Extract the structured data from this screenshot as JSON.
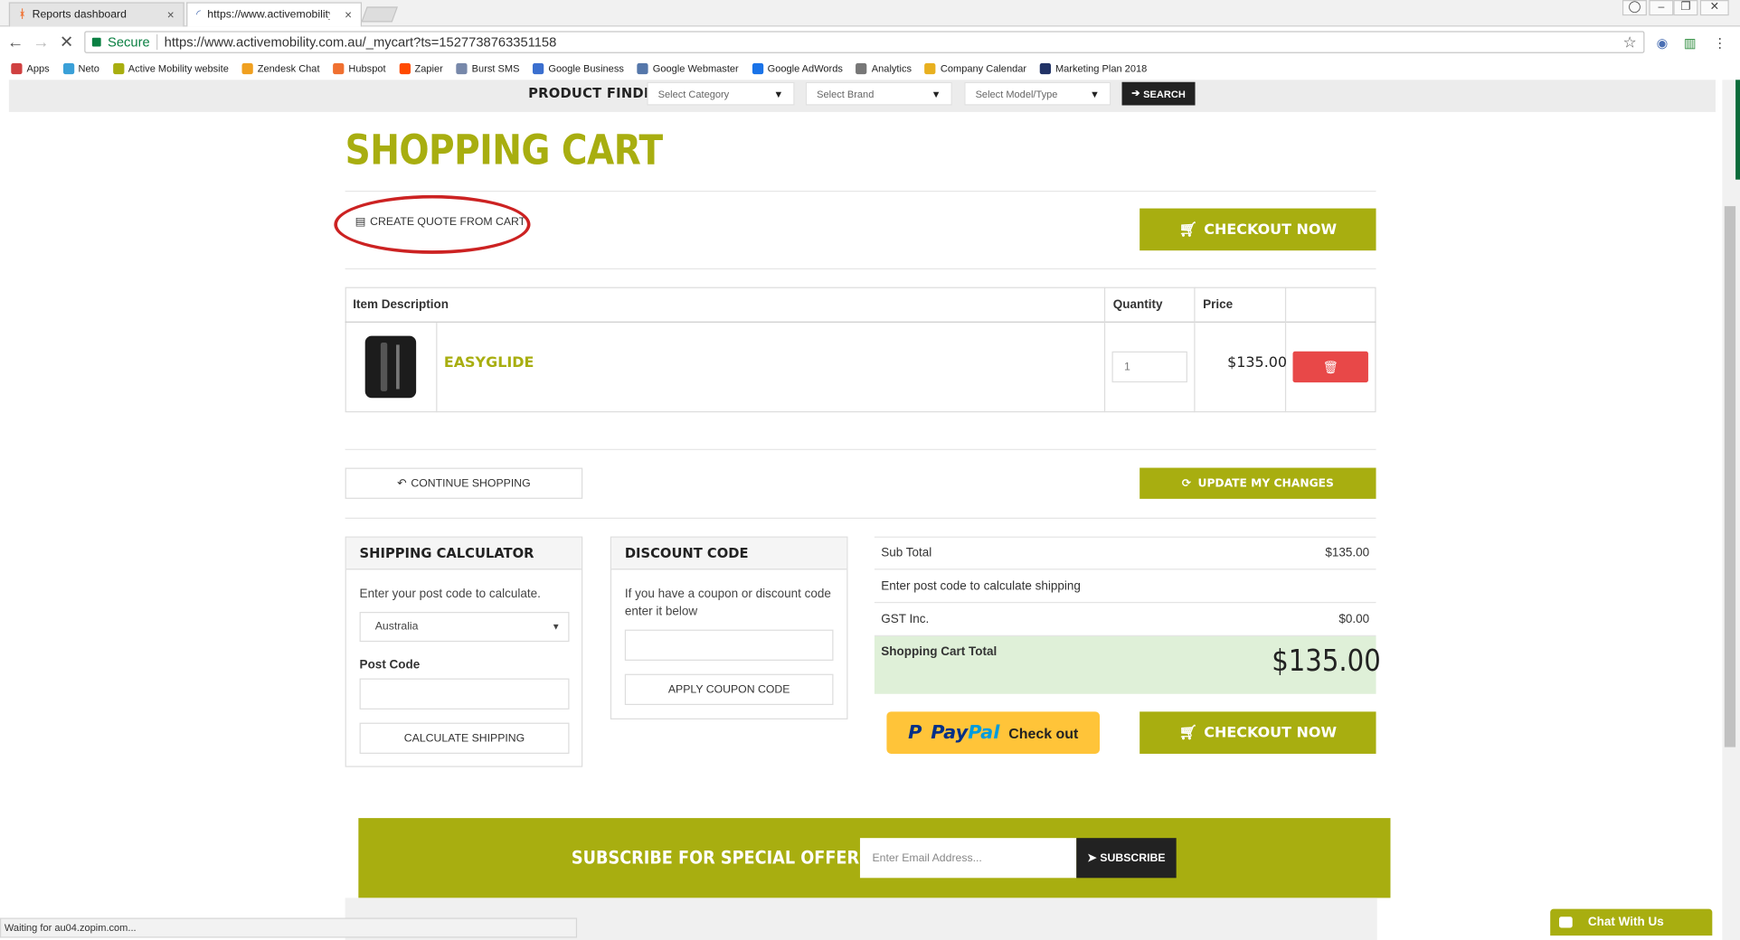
{
  "browser": {
    "tabs": [
      {
        "title": "Reports dashboard",
        "close": "×"
      },
      {
        "title": "https://www.activemobility",
        "close": "×"
      }
    ],
    "secure_label": "Secure",
    "url": "https://www.activemobility.com.au/_mycart?ts=1527738763351158",
    "bookmarks": [
      {
        "label": "Apps",
        "color": "#d04040"
      },
      {
        "label": "Neto",
        "color": "#3aa0d8"
      },
      {
        "label": "Active Mobility website",
        "color": "#a8ae10"
      },
      {
        "label": "Zendesk Chat",
        "color": "#f0a020"
      },
      {
        "label": "Hubspot",
        "color": "#f07030"
      },
      {
        "label": "Zapier",
        "color": "#ff4a00"
      },
      {
        "label": "Burst SMS",
        "color": "#7788aa"
      },
      {
        "label": "Google Business",
        "color": "#3b6fcf"
      },
      {
        "label": "Google Webmaster",
        "color": "#5577aa"
      },
      {
        "label": "Google AdWords",
        "color": "#1a73e8"
      },
      {
        "label": "Analytics",
        "color": "#777777"
      },
      {
        "label": "Company Calendar",
        "color": "#e8b020"
      },
      {
        "label": "Marketing Plan 2018",
        "color": "#223366"
      }
    ],
    "status_text": "Waiting for au04.zopim.com..."
  },
  "finder": {
    "label": "PRODUCT FINDER",
    "category": "Select Category",
    "brand": "Select Brand",
    "model": "Select Model/Type",
    "search": "SEARCH"
  },
  "cart": {
    "title": "SHOPPING CART",
    "quote_label": "CREATE QUOTE FROM CART",
    "checkout_label": "CHECKOUT NOW",
    "columns": {
      "item": "Item Description",
      "qty": "Quantity",
      "price": "Price"
    },
    "item": {
      "name": "EASYGLIDE",
      "qty": "1",
      "price": "$135.00"
    },
    "continue_label": "CONTINUE SHOPPING",
    "update_label": "UPDATE MY CHANGES"
  },
  "shipping": {
    "heading": "SHIPPING CALCULATOR",
    "instruction": "Enter your post code to calculate.",
    "country": "Australia",
    "postcode_label": "Post Code",
    "button": "CALCULATE SHIPPING"
  },
  "discount": {
    "heading": "DISCOUNT CODE",
    "instruction": "If you have a coupon or discount code enter it below",
    "button": "APPLY COUPON CODE"
  },
  "summary": {
    "subtotal_label": "Sub Total",
    "subtotal": "$135.00",
    "shipping_note": "Enter post code to calculate shipping",
    "gst_label": "GST Inc.",
    "gst": "$0.00",
    "total_label": "Shopping Cart Total",
    "total": "$135.00",
    "paypal_pay": "Pay",
    "paypal_pal": "Pal",
    "paypal_checkout": "Check out"
  },
  "subscribe": {
    "title": "SUBSCRIBE FOR SPECIAL OFFERS",
    "placeholder": "Enter Email Address...",
    "button": "SUBSCRIBE"
  },
  "chat": {
    "label": "Chat With Us"
  },
  "colors": {
    "accent": "#a8ae10",
    "danger": "#e84848",
    "total_bg": "#dff0d8"
  }
}
